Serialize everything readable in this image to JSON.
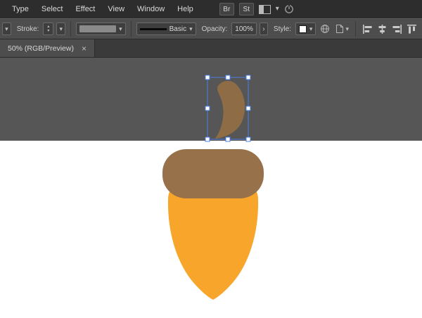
{
  "menu_bar": {
    "items": [
      "Type",
      "Select",
      "Effect",
      "View",
      "Window",
      "Help"
    ],
    "bridge_label": "Br",
    "stock_label": "St"
  },
  "control_bar": {
    "stroke_label": "Stroke:",
    "stroke_style_name": "Basic",
    "opacity_label": "Opacity:",
    "opacity_value": "100%",
    "more_label": "›",
    "style_label": "Style:"
  },
  "document_tab": {
    "title": "50% (RGB/Preview)",
    "close_label": "×"
  },
  "glyphs": {
    "chevron_down": "▾",
    "spinner_up": "▴",
    "spinner_down": "▾"
  },
  "canvas": {
    "colors": {
      "pasteboard": "#565656",
      "artboard": "#ffffff",
      "acorn_cap": "#97714A",
      "acorn_body": "#F7A62B",
      "stem": "#8E6C45",
      "selection_stroke": "#4A7FE0"
    }
  }
}
